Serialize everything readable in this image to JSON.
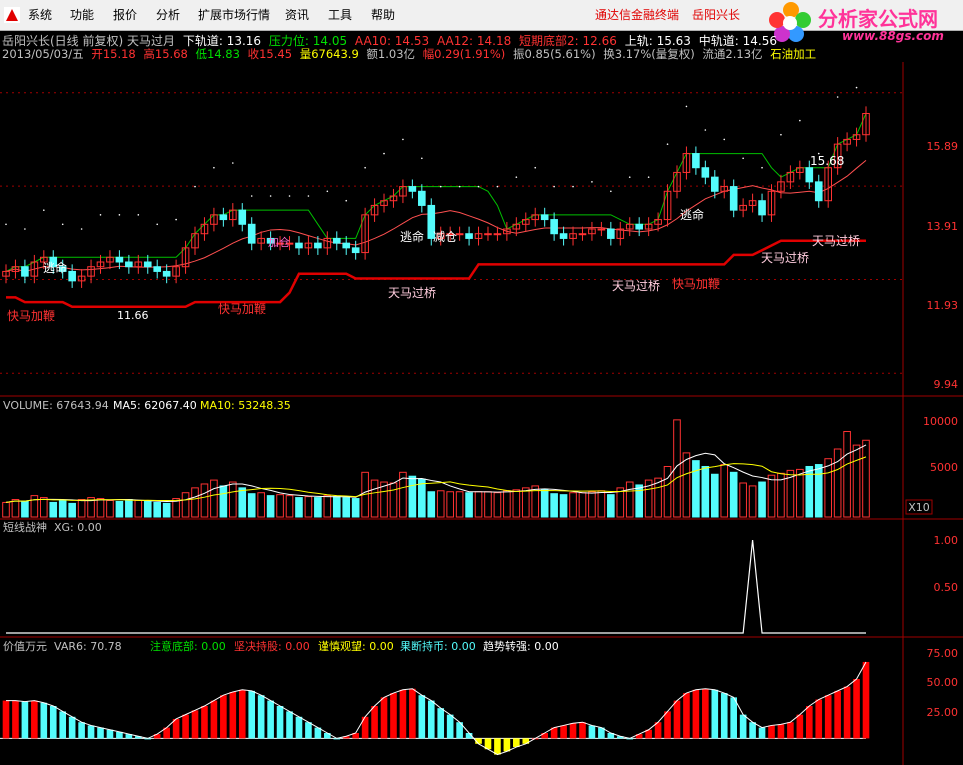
{
  "menu": {
    "items": [
      "系统",
      "功能",
      "报价",
      "分析",
      "扩展市场行情",
      "资讯",
      "工具",
      "帮助"
    ],
    "right_links": [
      "通达信金融终端",
      "岳阳兴长"
    ]
  },
  "logo": {
    "text": "分析家公式网",
    "url": "www.88gs.com"
  },
  "stock": {
    "title": "岳阳兴长(日线 前复权) 天马过月",
    "lower_rail": "下轨道: 13.16",
    "pressure": "压力位: 14.05",
    "aa10": "AA10: 14.53",
    "aa12": "AA12: 14.18",
    "short_bottom": "短期底部2: 12.66",
    "upper": "上轨: 15.63",
    "mid": "中轨道: 14.56",
    "date": "2013/05/03/五",
    "open": "开15.18",
    "high": "高15.68",
    "low": "低14.83",
    "close": "收15.45",
    "vol": "量67643.9",
    "amount": "额1.03亿",
    "range_pct": "幅0.29(1.91%)",
    "amp": "振0.85(5.61%)",
    "turnover": "换3.17%(量复权)",
    "float": "流通2.13亿",
    "industry": "石油加工"
  },
  "price_axis": {
    "ticks": [
      "15.89",
      "13.91",
      "11.93",
      "9.94"
    ]
  },
  "annotations": {
    "peak": "15.68",
    "low_mark": "11.66",
    "escape": "逃命",
    "reduce": "减仓",
    "jiaxi": "加仓",
    "fast": "快马加鞭",
    "tianma": "天马过桥",
    "zhuqi": "追击",
    "huai": "逃命"
  },
  "volume": {
    "label": "VOLUME: 67643.94",
    "ma5": "MA5: 62067.40",
    "ma10": "MA10: 53248.35",
    "ticks": [
      "10000",
      "5000"
    ],
    "unit": "X10"
  },
  "xg": {
    "label": "短线战神",
    "value": "XG: 0.00",
    "ticks": [
      "1.00",
      "0.50"
    ]
  },
  "var6": {
    "label": "价值万元",
    "value": "VAR6: 70.78",
    "zhuyi": "注意底部: 0.00",
    "jianjue": "坚决持股: 0.00",
    "jinshen": "谨慎观望: 0.00",
    "guoduan": "果断持币: 0.00",
    "qushi": "趋势转强: 0.00",
    "ticks": [
      "75.00",
      "50.00",
      "25.00"
    ]
  },
  "colors": {
    "up": "#ff3232",
    "down": "#54fcfc",
    "bg": "#000000",
    "red_line": "#e00000",
    "green_line": "#00c000"
  },
  "chart_data": {
    "type": "bar",
    "price_ylim": [
      9.5,
      16.5
    ],
    "closes": [
      12.1,
      12.2,
      12.0,
      12.3,
      12.4,
      12.2,
      12.1,
      11.9,
      12.0,
      12.2,
      12.3,
      12.4,
      12.3,
      12.2,
      12.3,
      12.2,
      12.1,
      12.0,
      12.2,
      12.6,
      12.9,
      13.1,
      13.3,
      13.2,
      13.4,
      13.1,
      12.7,
      12.8,
      12.7,
      12.7,
      12.7,
      12.6,
      12.7,
      12.6,
      12.8,
      12.7,
      12.6,
      12.5,
      13.3,
      13.5,
      13.6,
      13.7,
      13.9,
      13.8,
      13.5,
      12.8,
      12.9,
      12.9,
      12.9,
      12.8,
      12.9,
      12.9,
      12.9,
      13.0,
      13.1,
      13.2,
      13.3,
      13.2,
      12.9,
      12.8,
      12.9,
      12.9,
      13.0,
      13.0,
      12.8,
      13.0,
      13.1,
      13.0,
      13.1,
      13.2,
      13.8,
      14.2,
      14.6,
      14.3,
      14.1,
      13.8,
      13.9,
      13.4,
      13.5,
      13.6,
      13.3,
      13.8,
      14.0,
      14.2,
      14.3,
      14.0,
      13.6,
      14.3,
      14.8,
      14.9,
      15.0,
      15.45
    ],
    "volumes": [
      1500,
      1800,
      1600,
      2200,
      2000,
      1500,
      1700,
      1400,
      1800,
      2000,
      1900,
      1700,
      1600,
      1800,
      1700,
      1600,
      1500,
      1400,
      1900,
      2500,
      3000,
      3400,
      3800,
      3200,
      3600,
      3000,
      2400,
      2500,
      2200,
      2300,
      2200,
      2000,
      2100,
      2000,
      2200,
      2100,
      2000,
      1900,
      4600,
      3800,
      3600,
      3500,
      4600,
      4200,
      3900,
      2600,
      2700,
      2600,
      2600,
      2500,
      2600,
      2600,
      2500,
      2700,
      2800,
      3000,
      3200,
      2800,
      2400,
      2300,
      2500,
      2500,
      2600,
      2700,
      2300,
      3000,
      3600,
      3300,
      3800,
      4000,
      5200,
      10000,
      6600,
      5800,
      5200,
      4400,
      5400,
      4600,
      3500,
      3200,
      3600,
      4300,
      4500,
      4800,
      4900,
      5200,
      5400,
      6000,
      7000,
      8800,
      7400,
      7900
    ],
    "xg_values": [
      0,
      0,
      0,
      0,
      0,
      0,
      0,
      0,
      0,
      0,
      0,
      0,
      0,
      0,
      0,
      0,
      0,
      0,
      0,
      0,
      0,
      0,
      0,
      0,
      0,
      0,
      0,
      0,
      0,
      0,
      0,
      0,
      0,
      0,
      0,
      0,
      0,
      0,
      0,
      0,
      0,
      0,
      0,
      0,
      0,
      0,
      0,
      0,
      0,
      0,
      0,
      0,
      0,
      0,
      0,
      0,
      0,
      0,
      0,
      0,
      0,
      0,
      0,
      0,
      0,
      0,
      0,
      0,
      0,
      0,
      0,
      0,
      0,
      0,
      0,
      0,
      0,
      0,
      0,
      1,
      0,
      0,
      0,
      0,
      0,
      0,
      0,
      0,
      0,
      0,
      0,
      0
    ],
    "var6_values": [
      35,
      35,
      34,
      35,
      33,
      30,
      25,
      20,
      15,
      12,
      10,
      8,
      6,
      4,
      2,
      0,
      4,
      10,
      18,
      22,
      26,
      30,
      35,
      40,
      43,
      45,
      44,
      40,
      35,
      30,
      25,
      20,
      15,
      10,
      5,
      0,
      2,
      5,
      20,
      30,
      38,
      42,
      45,
      46,
      40,
      35,
      28,
      22,
      15,
      5,
      -5,
      -10,
      -15,
      -12,
      -8,
      -5,
      0,
      5,
      10,
      12,
      14,
      15,
      12,
      10,
      5,
      2,
      0,
      4,
      8,
      15,
      25,
      35,
      42,
      45,
      46,
      45,
      42,
      38,
      22,
      15,
      10,
      12,
      13,
      15,
      22,
      30,
      36,
      40,
      44,
      48,
      55,
      70.78
    ],
    "var6_ylim": [
      -20,
      80
    ]
  }
}
